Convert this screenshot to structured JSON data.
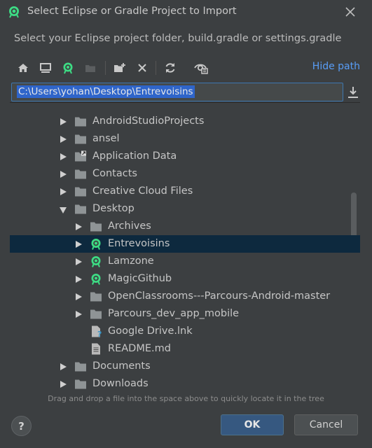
{
  "window": {
    "title": "Select Eclipse or Gradle Project to Import"
  },
  "subtitle": "Select your Eclipse project folder, build.gradle or settings.gradle",
  "toolbar": {
    "hide_path_label": "Hide path",
    "icons": [
      "home-icon",
      "desktop-icon",
      "android-project-icon",
      "module-icon",
      "new-folder-icon",
      "delete-icon",
      "refresh-icon",
      "show-hidden-icon"
    ]
  },
  "path": {
    "value": "C:\\Users\\yohan\\Desktop\\Entrevoisins"
  },
  "tree": {
    "items": [
      {
        "label": "AndroidStudioProjects",
        "type": "folder",
        "expander": "collapsed",
        "depth": 1
      },
      {
        "label": "ansel",
        "type": "folder",
        "expander": "collapsed",
        "depth": 1
      },
      {
        "label": "Application Data",
        "type": "folder-link",
        "expander": "collapsed",
        "depth": 1
      },
      {
        "label": "Contacts",
        "type": "folder",
        "expander": "collapsed",
        "depth": 1
      },
      {
        "label": "Creative Cloud Files",
        "type": "folder",
        "expander": "collapsed",
        "depth": 1
      },
      {
        "label": "Desktop",
        "type": "folder",
        "expander": "expanded",
        "depth": 1
      },
      {
        "label": "Archives",
        "type": "folder",
        "expander": "collapsed",
        "depth": 2
      },
      {
        "label": "Entrevoisins",
        "type": "android-project",
        "expander": "collapsed",
        "depth": 2,
        "selected": true
      },
      {
        "label": "Lamzone",
        "type": "android-project",
        "expander": "collapsed",
        "depth": 2
      },
      {
        "label": "MagicGithub",
        "type": "android-project",
        "expander": "collapsed",
        "depth": 2
      },
      {
        "label": "OpenClassrooms---Parcours-Android-master",
        "type": "folder",
        "expander": "collapsed",
        "depth": 2
      },
      {
        "label": "Parcours_dev_app_mobile",
        "type": "folder",
        "expander": "collapsed",
        "depth": 2
      },
      {
        "label": "Google Drive.lnk",
        "type": "file-unknown",
        "expander": "none",
        "depth": 2
      },
      {
        "label": "README.md",
        "type": "file-text",
        "expander": "none",
        "depth": 2
      },
      {
        "label": "Documents",
        "type": "folder",
        "expander": "collapsed",
        "depth": 1
      },
      {
        "label": "Downloads",
        "type": "folder",
        "expander": "collapsed",
        "depth": 1
      }
    ]
  },
  "hint": "Drag and drop a file into the space above to quickly locate it in the tree",
  "buttons": {
    "help": "?",
    "ok": "OK",
    "cancel": "Cancel"
  },
  "colors": {
    "background": "#3c3f41",
    "selection": "#0d293e",
    "link": "#589df6",
    "android_green": "#3ddc84",
    "primary_button": "#365880"
  }
}
